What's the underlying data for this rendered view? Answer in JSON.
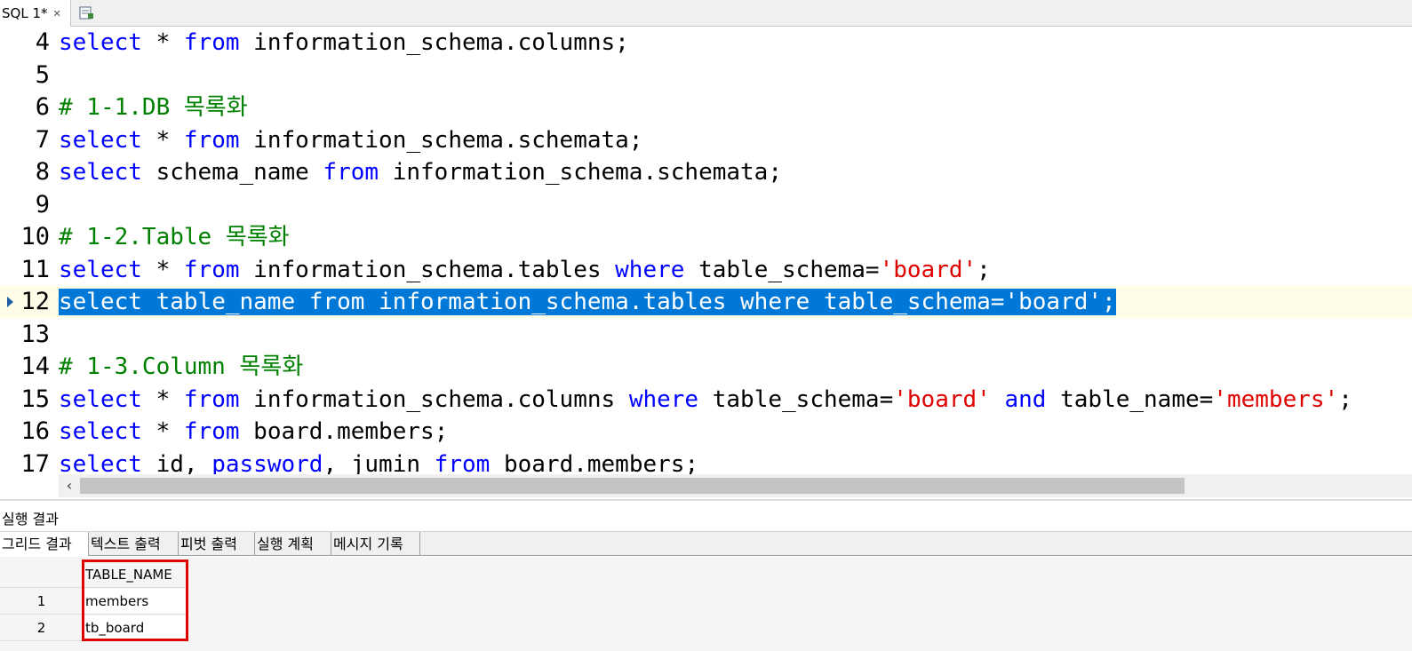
{
  "tabs": {
    "sql_tab_label": "SQL 1*",
    "close_icon": "close-icon",
    "new_tab_icon": "new-query-icon"
  },
  "editor": {
    "current_line_marker": "12",
    "lines": [
      {
        "num": "4",
        "segs": [
          [
            "kw",
            "select"
          ],
          [
            "t",
            " * "
          ],
          [
            "kw",
            "from"
          ],
          [
            "t",
            " information_schema.columns;"
          ]
        ]
      },
      {
        "num": "5",
        "segs": []
      },
      {
        "num": "6",
        "segs": [
          [
            "cmt",
            "# 1-1.DB 목록화"
          ]
        ]
      },
      {
        "num": "7",
        "segs": [
          [
            "kw",
            "select"
          ],
          [
            "t",
            " * "
          ],
          [
            "kw",
            "from"
          ],
          [
            "t",
            " information_schema.schemata;"
          ]
        ]
      },
      {
        "num": "8",
        "segs": [
          [
            "kw",
            "select"
          ],
          [
            "t",
            " schema_name "
          ],
          [
            "kw",
            "from"
          ],
          [
            "t",
            " information_schema.schemata;"
          ]
        ]
      },
      {
        "num": "9",
        "segs": []
      },
      {
        "num": "10",
        "segs": [
          [
            "cmt",
            "# 1-2.Table 목록화"
          ]
        ]
      },
      {
        "num": "11",
        "segs": [
          [
            "kw",
            "select"
          ],
          [
            "t",
            " * "
          ],
          [
            "kw",
            "from"
          ],
          [
            "t",
            " information_schema.tables "
          ],
          [
            "kw",
            "where"
          ],
          [
            "t",
            " table_schema="
          ],
          [
            "str",
            "'board'"
          ],
          [
            "t",
            ";"
          ]
        ]
      },
      {
        "num": "12",
        "segs": [
          [
            "kw",
            "select"
          ],
          [
            "t",
            " table_name "
          ],
          [
            "kw",
            "from"
          ],
          [
            "t",
            " information_schema.tables "
          ],
          [
            "kw",
            "where"
          ],
          [
            "t",
            " table_schema="
          ],
          [
            "str",
            "'board'"
          ],
          [
            "t",
            ";"
          ]
        ]
      },
      {
        "num": "13",
        "segs": []
      },
      {
        "num": "14",
        "segs": [
          [
            "cmt",
            "# 1-3.Column 목록화"
          ]
        ]
      },
      {
        "num": "15",
        "segs": [
          [
            "kw",
            "select"
          ],
          [
            "t",
            " * "
          ],
          [
            "kw",
            "from"
          ],
          [
            "t",
            " information_schema.columns "
          ],
          [
            "kw",
            "where"
          ],
          [
            "t",
            " table_schema="
          ],
          [
            "str",
            "'board'"
          ],
          [
            "t",
            " "
          ],
          [
            "kw",
            "and"
          ],
          [
            "t",
            " table_name="
          ],
          [
            "str",
            "'members'"
          ],
          [
            "t",
            ";"
          ]
        ]
      },
      {
        "num": "16",
        "segs": [
          [
            "kw",
            "select"
          ],
          [
            "t",
            " * "
          ],
          [
            "kw",
            "from"
          ],
          [
            "t",
            " board.members;"
          ]
        ]
      },
      {
        "num": "17",
        "segs": [
          [
            "kw",
            "select"
          ],
          [
            "t",
            " id, "
          ],
          [
            "kw",
            "password"
          ],
          [
            "t",
            ", jumin "
          ],
          [
            "kw",
            "from"
          ],
          [
            "t",
            " board.members;"
          ]
        ]
      }
    ]
  },
  "results": {
    "title": "실행 결과",
    "tabs": [
      "그리드 결과",
      "텍스트 출력",
      "피벗 출력",
      "실행 계획",
      "메시지 기록"
    ],
    "active_tab": "그리드 결과",
    "column_header": "TABLE_NAME",
    "rows": [
      {
        "num": "1",
        "value": "members"
      },
      {
        "num": "2",
        "value": "tb_board"
      }
    ]
  },
  "colors": {
    "keyword": "#0000ff",
    "string": "#e00000",
    "comment": "#008000",
    "selection": "#0078d7",
    "highlight_box": "#e00000"
  }
}
